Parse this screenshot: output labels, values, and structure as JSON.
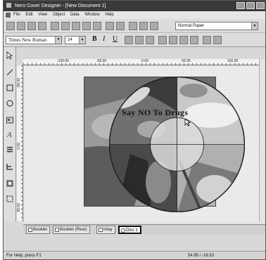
{
  "window": {
    "title": "Nero Cover Designer - [New Document 1]"
  },
  "menu": [
    "File",
    "Edit",
    "View",
    "Object",
    "Data",
    "Window",
    "Help"
  ],
  "toolbar": {
    "paper_select": "Normal Paper",
    "icons": [
      "new-icon",
      "open-icon",
      "save-icon",
      "print-icon",
      "cut-icon",
      "copy-icon",
      "paste-icon",
      "delete-icon",
      "properties-icon",
      "undo-icon",
      "redo-icon",
      "info-icon",
      "zoom-icon",
      "settings-icon"
    ]
  },
  "format_bar": {
    "font": "Times New Roman",
    "size": "24",
    "bold": "B",
    "italic": "I",
    "underline": "U"
  },
  "ruler": {
    "h_labels": [
      "-100.00",
      "-50.00",
      "0.00",
      "50.00",
      "100.00"
    ],
    "v_labels": [
      "-50.00",
      "0.00",
      "50.00"
    ]
  },
  "document": {
    "disc_title": "Say  NO  To Drugs"
  },
  "tabs": [
    {
      "label": "Booklet",
      "active": false
    },
    {
      "label": "Booklet (Rear)",
      "active": false
    },
    {
      "label": "Inlay",
      "active": false
    },
    {
      "label": "Disc 1",
      "active": true
    }
  ],
  "status": {
    "help": "For Help, press F1",
    "coords": "54.95 / -16.53"
  },
  "colors": {
    "titlebar": "#3a3a3a",
    "canvas": "#ececec",
    "paper": "#8a8a8a"
  }
}
